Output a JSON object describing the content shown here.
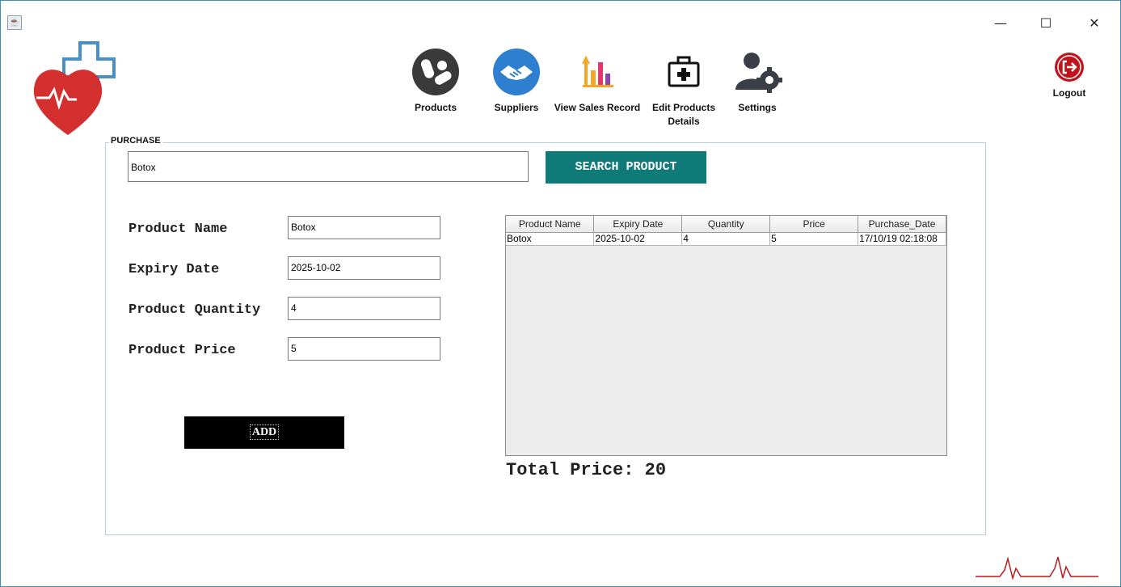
{
  "window": {
    "minimize": "—",
    "maximize": "☐",
    "close": "✕"
  },
  "nav": {
    "items": [
      {
        "label": "Products",
        "icon": "pills-icon"
      },
      {
        "label": "Suppliers",
        "icon": "handshake-icon"
      },
      {
        "label": "View Sales Record",
        "icon": "bar-chart-icon"
      },
      {
        "label": "Edit Products\nDetails",
        "icon": "first-aid-kit-icon"
      },
      {
        "label": "Settings",
        "icon": "user-gear-icon"
      }
    ],
    "logout": "Logout"
  },
  "purchase": {
    "title": "PURCHASE",
    "search_value": "Botox",
    "search_button": "SEARCH PRODUCT",
    "fields": {
      "product_name_label": "Product Name",
      "product_name_value": "Botox",
      "expiry_date_label": "Expiry Date",
      "expiry_date_value": "2025-10-02",
      "quantity_label": "Product Quantity",
      "quantity_value": "4",
      "price_label": "Product Price",
      "price_value": "5"
    },
    "add_button": "ADD",
    "table": {
      "headers": [
        "Product Name",
        "Expiry Date",
        "Quantity",
        "Price",
        "Purchase_Date"
      ],
      "rows": [
        [
          "Botox",
          "2025-10-02",
          "4",
          "5",
          "17/10/19 02:18:08"
        ]
      ]
    },
    "total": "Total Price: 20"
  },
  "colors": {
    "search_button": "#0e7b78",
    "add_button": "#000000",
    "logout": "#c0141c",
    "logo_heart": "#d32f2f",
    "logo_cross": "#4a90c8"
  }
}
